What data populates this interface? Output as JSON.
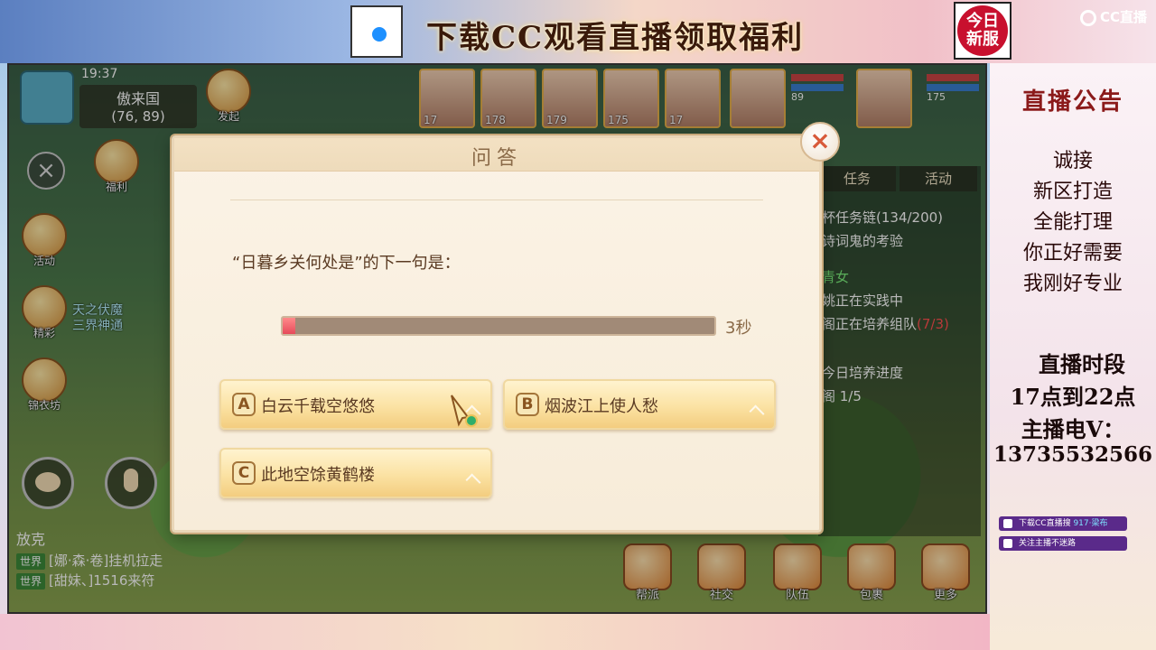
{
  "stream": {
    "banner": "下载CC观看直播领取福利",
    "new_server_badge": "今日\n新服",
    "cc_logo": "CC直播"
  },
  "announcement": {
    "title": "直播公告",
    "lines": [
      "诚接",
      "新区打造",
      "全能打理",
      "你正好需要",
      "我刚好专业"
    ],
    "schedule_title": "直播时段",
    "schedule": "17点到22点",
    "contact_label": "主播电V：",
    "contact_number": "13735532566",
    "pill_download_prefix": "下载CC直播搜",
    "pill_download_accent": "917·梁布",
    "pill_follow": "关注主播不迷路"
  },
  "game_hud": {
    "clock": "19:37",
    "map_name": "傲来国",
    "map_coords": "(76, 89)",
    "buttons": [
      {
        "label": "发起"
      },
      {
        "label": "福利"
      },
      {
        "label": "活动"
      },
      {
        "label": "精彩"
      },
      {
        "label": "锦衣坊"
      }
    ],
    "event_text_line1": "天之伏魔",
    "event_text_line2": "三界神通",
    "quest_tabs": [
      "任务",
      "活动"
    ],
    "quest_lines": [
      {
        "text": "杯任务链(134/200)"
      },
      {
        "text": "诗词鬼的考验"
      },
      {
        "text": "青女"
      },
      {
        "text": "姚正在实践中"
      },
      {
        "text": "阁正在培养组队",
        "red": "(7/3)"
      },
      {
        "text": "今日培养进度"
      },
      {
        "text": "阁 1/5"
      }
    ],
    "bottom_buttons": [
      {
        "label": "帮派"
      },
      {
        "label": "社交"
      },
      {
        "label": "队伍"
      },
      {
        "label": "包裹"
      },
      {
        "label": "更多"
      }
    ],
    "party_levels": [
      "17",
      "178",
      "179",
      "175",
      "17"
    ],
    "hp_labels": [
      "89",
      "175"
    ]
  },
  "chat": {
    "header": "放克",
    "rows": [
      {
        "tag": "世界",
        "text": "[娜·森·卷]挂机拉走"
      },
      {
        "tag": "世界",
        "text": "[甜妹、]1516来符"
      }
    ]
  },
  "quiz": {
    "title": "问答",
    "question": "“日暮乡关何处是”的下一句是：",
    "timer_text": "3秒",
    "timer_fraction": 0.03,
    "options": [
      {
        "letter": "A",
        "text": "白云千载空悠悠"
      },
      {
        "letter": "B",
        "text": "烟波江上使人愁"
      },
      {
        "letter": "C",
        "text": "此地空馀黄鹤楼"
      }
    ],
    "close_symbol": "×"
  },
  "colors": {
    "modal_bg": "#fbf3e6",
    "option_gold": "#fbe2a3",
    "timer_fill": "#e64a5a",
    "title_brown": "#8a6a48"
  }
}
